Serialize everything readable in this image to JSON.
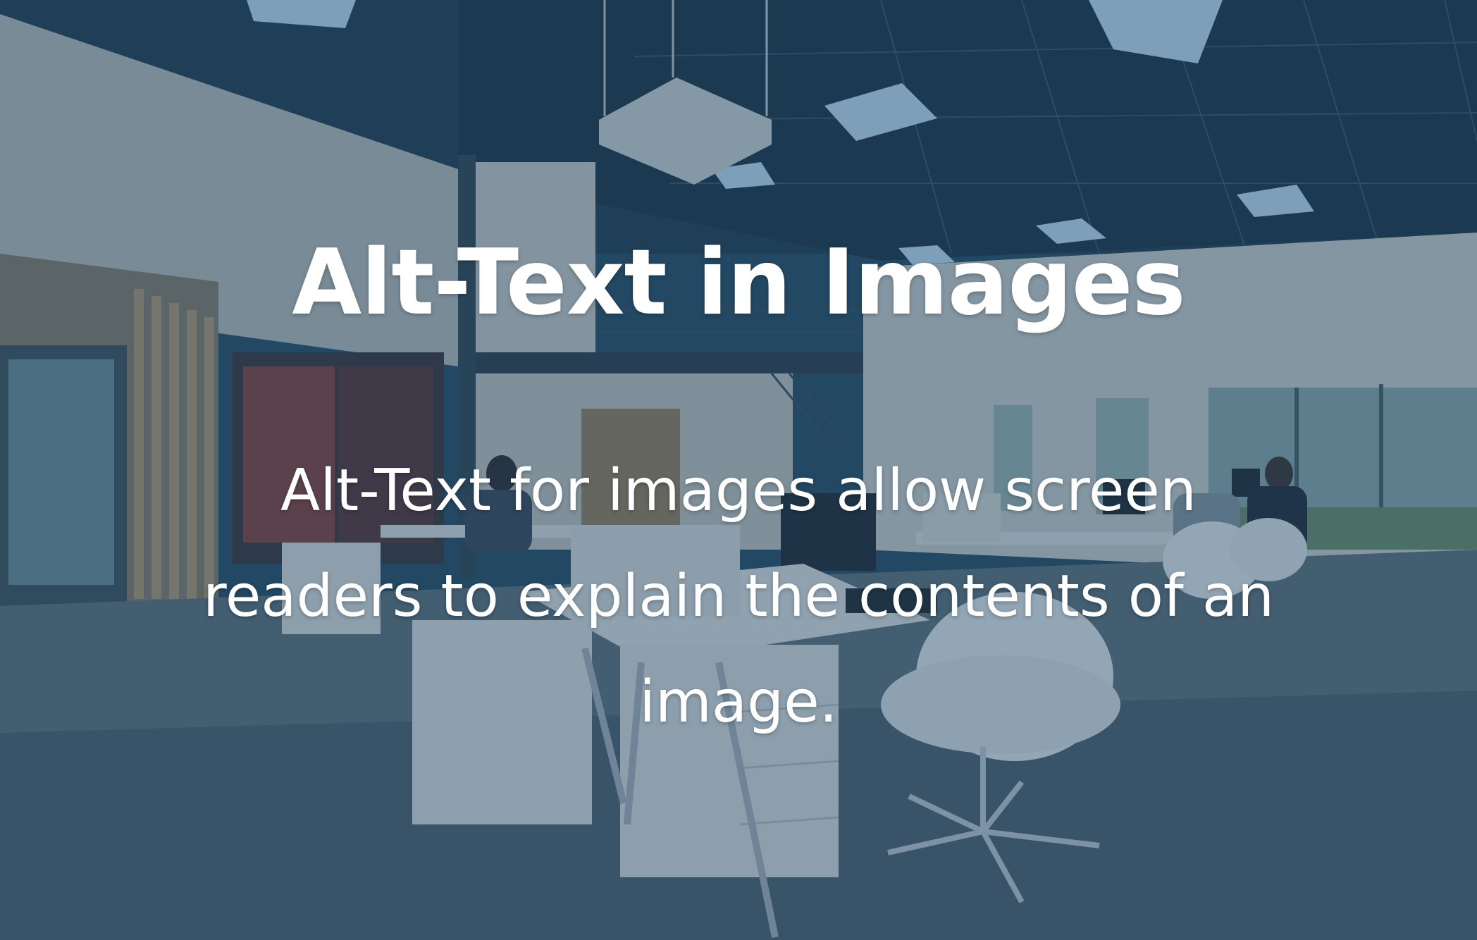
{
  "hero": {
    "title": "Alt-Text in Images",
    "description": "Alt-Text for images allow screen readers to explain the contents of an image.",
    "overlay_color": "#214b6e",
    "text_color": "#ffffff"
  }
}
